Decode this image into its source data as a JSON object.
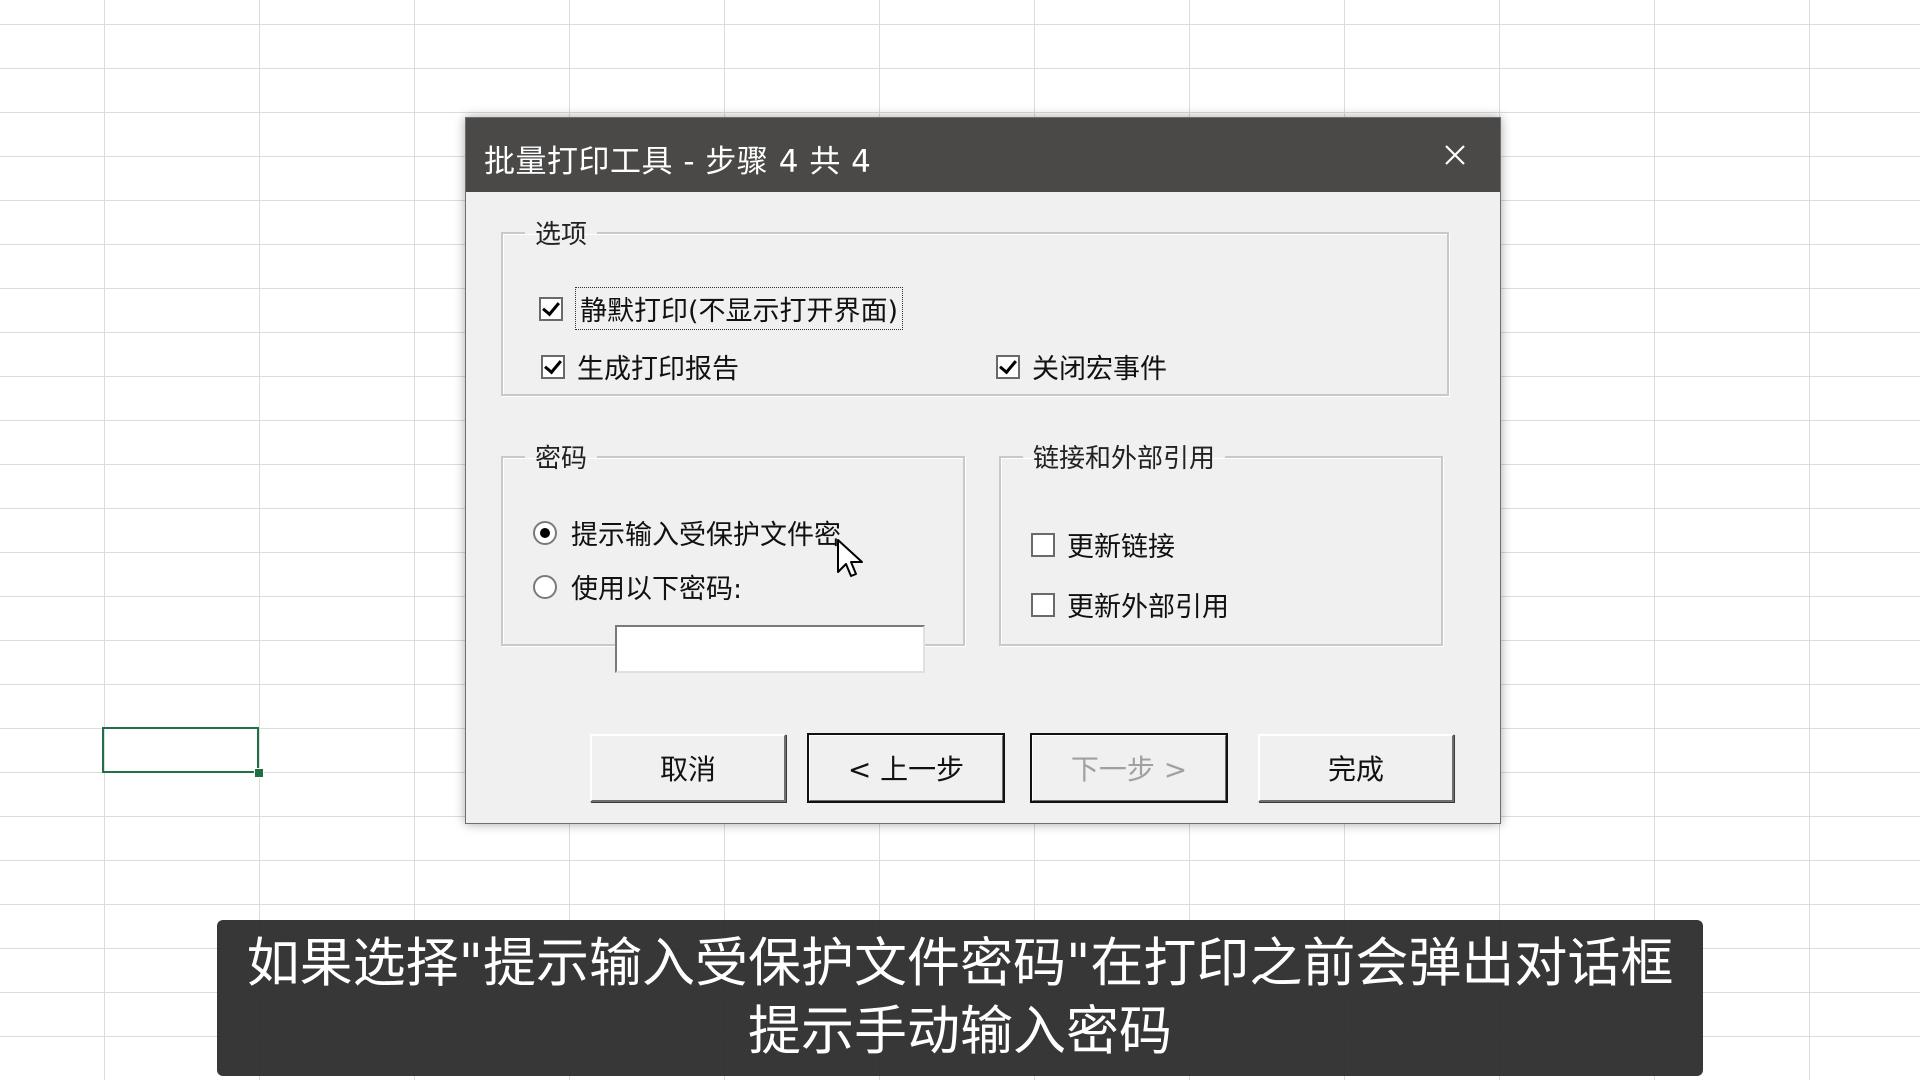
{
  "dialog": {
    "title": "批量打印工具 - 步骤 4 共 4",
    "options": {
      "legend": "选项",
      "silent_print": {
        "label": "静默打印(不显示打开界面)",
        "checked": true
      },
      "generate_report": {
        "label": "生成打印报告",
        "checked": true
      },
      "disable_macros": {
        "label": "关闭宏事件",
        "checked": true
      }
    },
    "password": {
      "legend": "密码",
      "prompt_radio": {
        "label": "提示输入受保护文件密",
        "selected": true
      },
      "use_following": {
        "label": "使用以下密码:",
        "selected": false
      },
      "password_value": ""
    },
    "links": {
      "legend": "链接和外部引用",
      "update_links": {
        "label": "更新链接",
        "checked": false
      },
      "update_external": {
        "label": "更新外部引用",
        "checked": false
      }
    },
    "buttons": {
      "cancel": "取消",
      "back": "< 上一步",
      "next": "下一步 >",
      "finish": "完成"
    }
  },
  "subtitle": {
    "line1": "如果选择\"提示输入受保护文件密码\"在打印之前会弹出对话框",
    "line2": "提示手动输入密码"
  },
  "colors": {
    "titlebar": "#4a4948",
    "dialog_bg": "#f0f0f0",
    "cell_selection": "#1e7145"
  }
}
